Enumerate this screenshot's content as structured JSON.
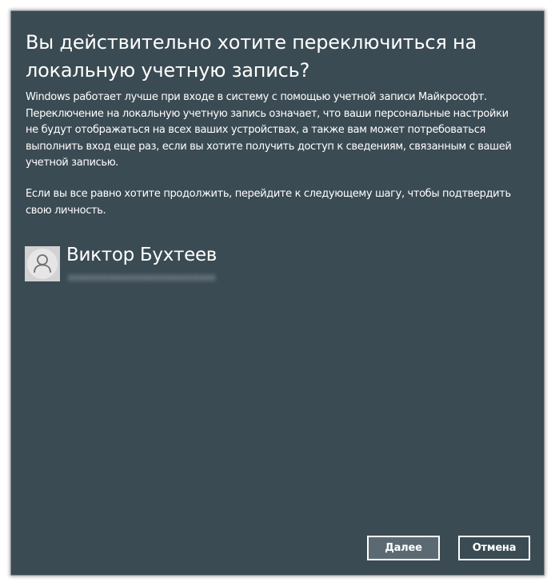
{
  "dialog": {
    "title": "Вы действительно хотите переключиться на локальную учетную запись?",
    "paragraph1": "Windows работает лучше при входе в систему с помощью учетной записи Майкрософт. Переключение на локальную учетную запись означает, что ваши персональные настройки не будут отображаться на всех ваших устройствах, а также вам может потребоваться выполнить вход еще раз, если вы хотите получить доступ к сведениям, связанным с вашей учетной записью.",
    "paragraph2": "Если вы все равно хотите продолжить, перейдите к следующему шагу, чтобы подтвердить свою личность."
  },
  "account": {
    "name": "Виктор Бухтеев",
    "avatar_icon": "user-icon"
  },
  "buttons": {
    "next_label": "Далее",
    "cancel_label": "Отмена"
  },
  "colors": {
    "dialog_background": "#3b4b53",
    "primary_button_background": "#5b6a72",
    "text": "#ffffff"
  }
}
